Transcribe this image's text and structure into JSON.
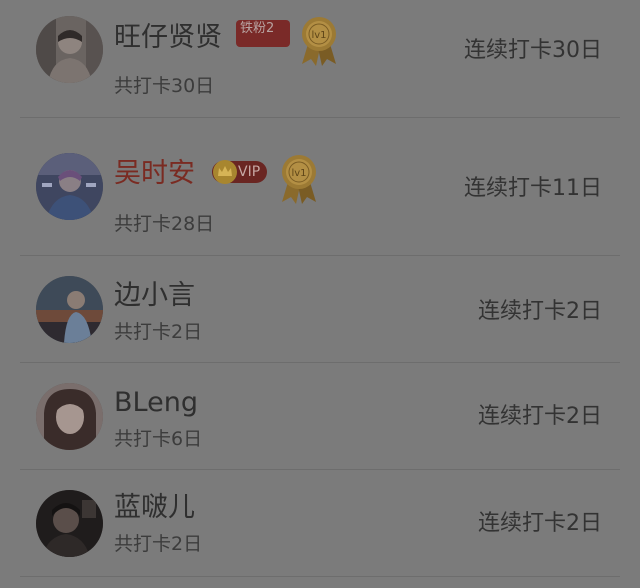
{
  "leaderboard": {
    "rows": [
      {
        "name": "旺仔贤贤",
        "subtitle": "共打卡30日",
        "streak": "连续打卡30日",
        "badge": "铁粉2",
        "medal_text": "lv1",
        "name_color": "#2f2f2f",
        "avatar_icon": "avatar-photo-icon"
      },
      {
        "name": "吴时安",
        "subtitle": "共打卡28日",
        "streak": "连续打卡11日",
        "badge": "VIP",
        "medal_text": "lv1",
        "name_color": "#7a2b22",
        "avatar_icon": "avatar-photo-icon"
      },
      {
        "name": "边小言",
        "subtitle": "共打卡2日",
        "streak": "连续打卡2日",
        "badge": "",
        "medal_text": "",
        "name_color": "#2f2f2f",
        "avatar_icon": "avatar-photo-icon"
      },
      {
        "name": "BLeng",
        "subtitle": "共打卡6日",
        "streak": "连续打卡2日",
        "badge": "",
        "medal_text": "",
        "name_color": "#2f2f2f",
        "avatar_icon": "avatar-photo-icon"
      },
      {
        "name": "蓝啵儿",
        "subtitle": "共打卡2日",
        "streak": "连续打卡2日",
        "badge": "",
        "medal_text": "",
        "name_color": "#2f2f2f",
        "avatar_icon": "avatar-photo-icon"
      }
    ]
  }
}
